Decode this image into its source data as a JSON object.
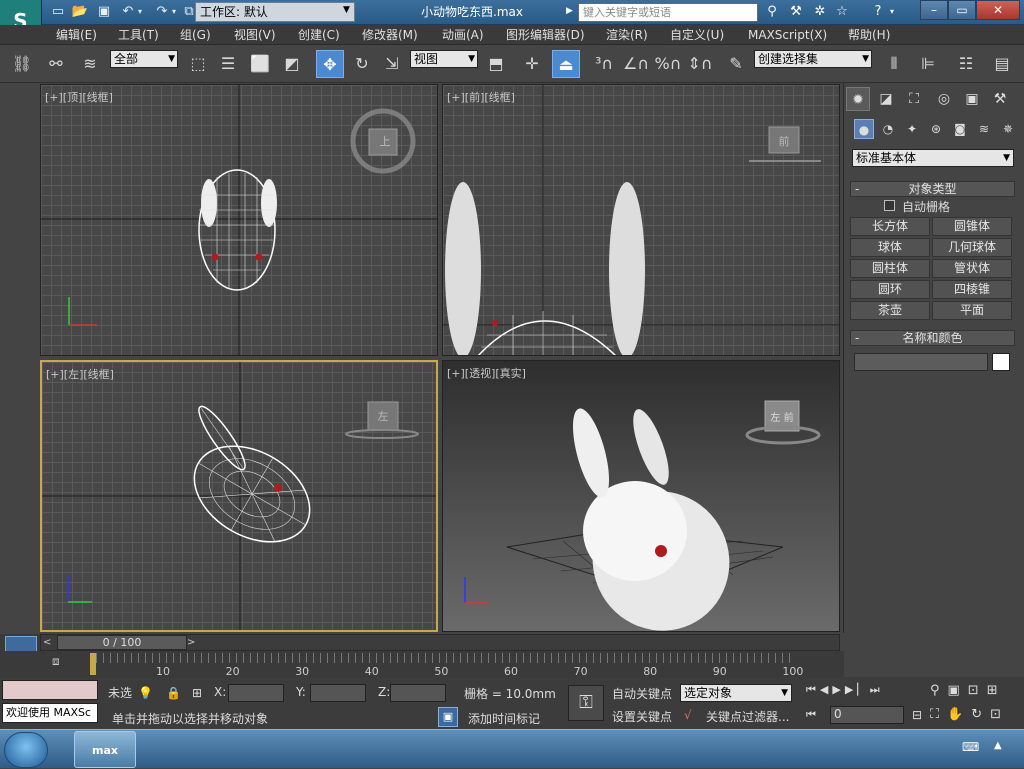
{
  "title_bar": {
    "workspace_value": "工作区: 默认",
    "document_title": "小动物吃东西.max",
    "search_placeholder": "键入关键字或短语"
  },
  "menu": {
    "items": [
      "编辑(E)",
      "工具(T)",
      "组(G)",
      "视图(V)",
      "创建(C)",
      "修改器(M)",
      "动画(A)",
      "图形编辑器(D)",
      "渲染(R)",
      "自定义(U)",
      "MAXScript(X)",
      "帮助(H)"
    ]
  },
  "toolbar": {
    "selection_filter": "全部",
    "ref_coord": "视图",
    "named_selection": "创建选择集"
  },
  "viewports": {
    "top": {
      "label": "[+][顶][线框]",
      "cube_text": "上"
    },
    "front": {
      "label": "[+][前][线框]",
      "cube_text": "前"
    },
    "left": {
      "label": "[+][左][线框]",
      "cube_text": "左"
    },
    "perspective": {
      "label": "[+][透视][真实]",
      "cube_text": "左 前"
    }
  },
  "command_panel": {
    "category": "标准基本体",
    "object_type_title": "对象类型",
    "auto_grid_label": "自动栅格",
    "objects": [
      "长方体",
      "圆锥体",
      "球体",
      "几何球体",
      "圆柱体",
      "管状体",
      "圆环",
      "四棱锥",
      "茶壶",
      "平面"
    ],
    "name_color_title": "名称和颜色",
    "swatch_color": "#ffffff"
  },
  "timeline": {
    "slider_text": "0 / 100",
    "ticks": [
      "10",
      "20",
      "30",
      "40",
      "50",
      "60",
      "70",
      "80",
      "90",
      "100"
    ]
  },
  "status": {
    "maxscript_text": "欢迎使用 MAXSc",
    "selection_text": "未选",
    "x_label": "X:",
    "y_label": "Y:",
    "z_label": "Z:",
    "grid_text": "栅格 = 10.0mm",
    "prompt_text": "单击并拖动以选择并移动对象",
    "add_time_tag": "添加时间标记",
    "auto_key": "自动关键点",
    "set_key": "设置关键点",
    "key_filter_value": "选定对象",
    "key_filters": "关键点过滤器...",
    "frame_value": "0"
  },
  "taskbar": {
    "app_label": "max"
  },
  "colors": {
    "accent": "#4b8ad1",
    "active_viewport_border": "#c8a84a",
    "eye_red": "#b01c1c"
  }
}
